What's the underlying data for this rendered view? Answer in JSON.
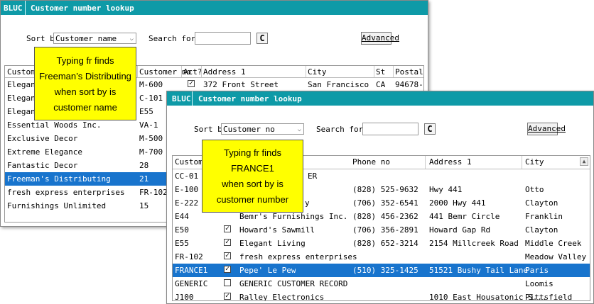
{
  "win1": {
    "code": "BLUC",
    "title": "Customer number lookup",
    "sort_label": "Sort by",
    "sort_value": "Customer name",
    "search_label": "Search for",
    "search_value": "",
    "refresh_glyph": "C",
    "advanced_label": "Advanced",
    "columns": [
      "Customer",
      "Customer no",
      "Act?",
      "Address 1",
      "City",
      "St",
      "Postal"
    ],
    "rows": [
      {
        "name": "Elegant",
        "no": "M-600",
        "act": true,
        "addr": "372 Front Street",
        "city": "San Francisco",
        "st": "CA",
        "postal": "94678-1"
      },
      {
        "name": "Elegant",
        "no": "C-101"
      },
      {
        "name": "Elegant",
        "no": "E55"
      },
      {
        "name": "Essential Woods Inc.",
        "no": "VA-1"
      },
      {
        "name": "Exclusive Decor",
        "no": "M-500"
      },
      {
        "name": "Extreme Elegance",
        "no": "M-700"
      },
      {
        "name": "Fantastic Decor",
        "no": "28"
      },
      {
        "name": "Freeman's Distributing",
        "no": "21",
        "selected": true
      },
      {
        "name": "fresh express enterprises",
        "no": "FR-102"
      },
      {
        "name": "Furnishings Unlimited",
        "no": "15"
      }
    ]
  },
  "win2": {
    "code": "BLUC",
    "title": "Customer number lookup",
    "sort_label": "Sort by",
    "sort_value": "Customer no",
    "search_label": "Search for",
    "search_value": "",
    "refresh_glyph": "C",
    "advanced_label": "Advanced",
    "columns": [
      "Customer",
      "Phone no",
      "Address 1",
      "City"
    ],
    "rows": [
      {
        "no": "CC-01",
        "act": null,
        "name": "ER",
        "phone": "",
        "addr": "",
        "city": ""
      },
      {
        "no": "E-100",
        "act": null,
        "name": "",
        "phone": "(828) 525-9632",
        "addr": "Hwy 441",
        "city": "Otto"
      },
      {
        "no": "E-222",
        "act": null,
        "name": "y",
        "phone": "(706) 352-6541",
        "addr": "2000 Hwy 441",
        "city": "Clayton"
      },
      {
        "no": "E44",
        "act": null,
        "name": "Bemr's Furnishings Inc.",
        "phone": "(828) 456-2362",
        "addr": "441 Bemr Circle",
        "city": "Franklin"
      },
      {
        "no": "E50",
        "act": true,
        "name": "Howard's Sawmill",
        "phone": "(706) 356-2891",
        "addr": "Howard Gap Rd",
        "city": "Clayton"
      },
      {
        "no": "E55",
        "act": true,
        "name": "Elegant Living",
        "phone": "(828) 652-3214",
        "addr": "2154 Millcreek Road",
        "city": "Middle Creek"
      },
      {
        "no": "FR-102",
        "act": true,
        "name": "fresh express enterprises",
        "phone": "",
        "addr": "",
        "city": "Meadow Valley"
      },
      {
        "no": "FRANCE1",
        "act": true,
        "name": "Pepe' Le Pew",
        "phone": "(510) 325-1425",
        "addr": "51521 Bushy Tail Lane",
        "city": "Paris",
        "selected": true
      },
      {
        "no": "GENERIC",
        "act": false,
        "name": "GENERIC CUSTOMER RECORD",
        "phone": "",
        "addr": "",
        "city": "Loomis"
      },
      {
        "no": "J100",
        "act": true,
        "name": "Ralley Electronics",
        "phone": "",
        "addr": "1010 East Housatonic S...",
        "city": "Pittsfield"
      }
    ]
  },
  "callout1": [
    "Typing fr finds",
    "Freeman’s Distributing",
    "when sort by is",
    "customer name"
  ],
  "callout2": [
    "Typing fr finds",
    "FRANCE1",
    "when sort by is",
    "customer number"
  ]
}
